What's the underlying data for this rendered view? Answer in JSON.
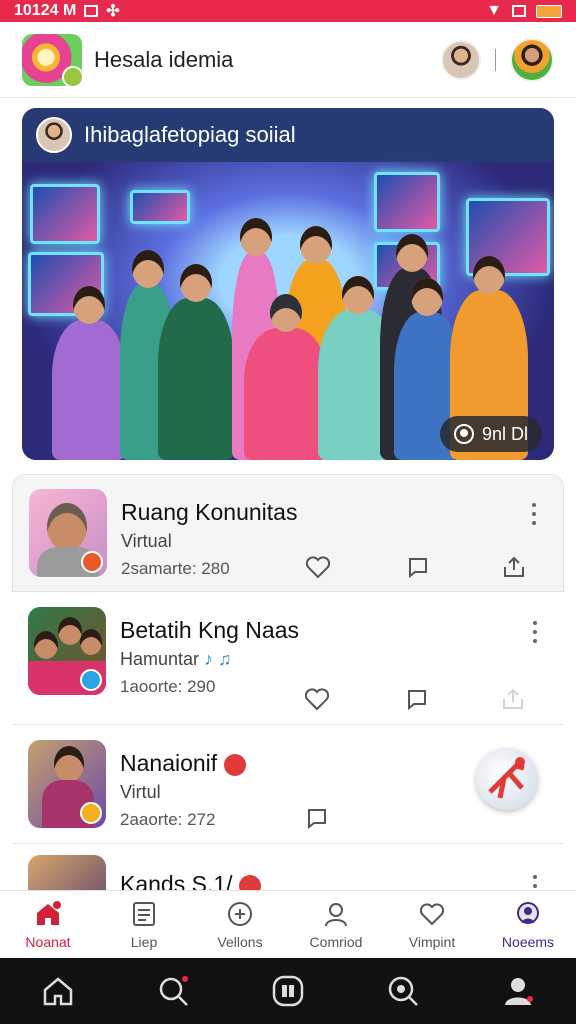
{
  "status_bar": {
    "time": "10124 M",
    "colors": {
      "background": "#e8284c"
    }
  },
  "header": {
    "title": "Hesala idemia",
    "app_icon": "app-logo-icon"
  },
  "banner": {
    "title": "Ihibaglafetopiag soiial",
    "pill_label": "9nl Dl",
    "pill_icon": "user-circle-icon"
  },
  "cards": [
    {
      "title": "Ruang Konunitas",
      "subtitle": "Virtual",
      "meta": "2samarte: 280"
    },
    {
      "title": "Betatih Kng Naas",
      "subtitle": "Hamuntar",
      "subtitle_icon": "♪ ♫",
      "meta": "1aoorte: 290"
    },
    {
      "title": "Nanaionif",
      "subtitle": "Virtul",
      "meta": "2aaorte: 272"
    },
    {
      "title": "Kands S.1/",
      "subtitle": "",
      "meta": ""
    }
  ],
  "tabs": [
    {
      "label": "Noanat",
      "icon": "home-icon"
    },
    {
      "label": "Liep",
      "icon": "list-icon"
    },
    {
      "label": "Vellons",
      "icon": "game-icon"
    },
    {
      "label": "Comriod",
      "icon": "person-icon"
    },
    {
      "label": "Vimpint",
      "icon": "heart-icon"
    },
    {
      "label": "Noeems",
      "icon": "profile-icon"
    }
  ],
  "colors": {
    "accent": "#d3213c",
    "nav": "#111111"
  }
}
